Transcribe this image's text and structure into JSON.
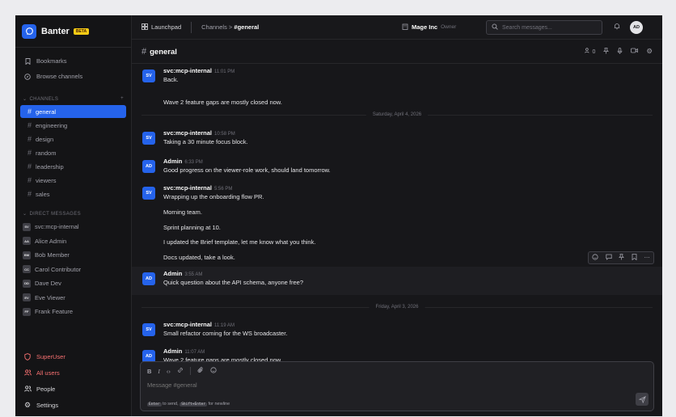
{
  "brand": {
    "name": "Banter",
    "badge": "BETA",
    "logo_icon": "chat-bubble-icon"
  },
  "nav": {
    "bookmarks": "Bookmarks",
    "browse": "Browse channels"
  },
  "channels": {
    "header": "CHANNELS",
    "items": [
      "general",
      "engineering",
      "design",
      "random",
      "leadership",
      "viewers",
      "sales"
    ],
    "active": "general"
  },
  "dms": {
    "header": "DIRECT MESSAGES",
    "items": [
      {
        "initials": "SV",
        "name": "svc:mcp-internal"
      },
      {
        "initials": "AA",
        "name": "Alice Admin"
      },
      {
        "initials": "BM",
        "name": "Bob Member"
      },
      {
        "initials": "CC",
        "name": "Carol Contributor"
      },
      {
        "initials": "DD",
        "name": "Dave Dev"
      },
      {
        "initials": "EV",
        "name": "Eve Viewer"
      },
      {
        "initials": "FF",
        "name": "Frank Feature"
      }
    ]
  },
  "sidebar_bottom": {
    "superuser": "SuperUser",
    "all_users": "All users",
    "people": "People",
    "settings": "Settings"
  },
  "topbar": {
    "launchpad": "Launchpad",
    "crumb_parent": "Channels",
    "crumb_sep": ">",
    "crumb_current": "#general",
    "org": "Mage Inc",
    "role": "Owner",
    "search_placeholder": "Search messages...",
    "user_initials": "AD"
  },
  "channel_header": {
    "hash": "#",
    "title": "general",
    "members_count": "0"
  },
  "messages": {
    "m1": {
      "initials": "SV",
      "author": "svc:mcp-internal",
      "time": "11:01 PM",
      "text": "Back."
    },
    "m1b": "Wave 2 feature gaps are mostly closed now.",
    "d1": "Saturday, April 4, 2026",
    "m2": {
      "initials": "SV",
      "author": "svc:mcp-internal",
      "time": "10:58 PM",
      "text": "Taking a 30 minute focus block."
    },
    "m3": {
      "initials": "AD",
      "author": "Admin",
      "time": "6:33 PM",
      "text": "Good progress on the viewer-role work, should land tomorrow."
    },
    "m4": {
      "initials": "SV",
      "author": "svc:mcp-internal",
      "time": "5:56 PM",
      "text": "Wrapping up the onboarding flow PR."
    },
    "p1": "Morning team.",
    "p2": "Sprint planning at 10.",
    "p3": "I updated the Brief template, let me know what you think.",
    "p4": "Docs updated, take a look.",
    "m5": {
      "initials": "AD",
      "author": "Admin",
      "time": "3:55 AM",
      "text": "Quick question about the API schema, anyone free?"
    },
    "d2": "Friday, April 3, 2026",
    "m6": {
      "initials": "SV",
      "author": "svc:mcp-internal",
      "time": "11:19 AM",
      "text": "Small refactor coming for the WS broadcaster."
    },
    "m7": {
      "initials": "AD",
      "author": "Admin",
      "time": "11:07 AM",
      "text": "Wave 2 feature gaps are mostly closed now."
    }
  },
  "composer": {
    "placeholder": "Message #general",
    "hint_enter": "Enter",
    "hint_to_send": "to send,",
    "hint_shift": "Shift+Enter",
    "hint_newline": "for newline"
  },
  "colors": {
    "accent": "#2563eb",
    "danger": "#f87171",
    "beta": "#facc15"
  }
}
